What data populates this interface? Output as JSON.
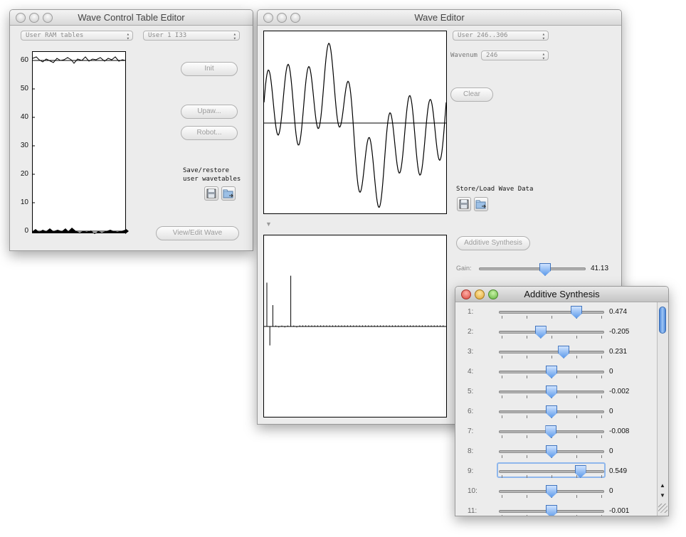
{
  "wave_control": {
    "title": "Wave Control Table Editor",
    "table_select": "User RAM tables",
    "user_select": "User   1 I33",
    "y_ticks": [
      "60",
      "50",
      "40",
      "30",
      "20",
      "10",
      "0"
    ],
    "init_label": "Init",
    "upaw_label": "Upaw...",
    "robot_label": "Robot...",
    "save_restore_line1": "Save/restore",
    "save_restore_line2": "user wavetables",
    "view_edit_label": "View/Edit Wave"
  },
  "wave_editor": {
    "title": "Wave Editor",
    "user_select": "User 246..306",
    "wavenum_label": "Wavenum",
    "wavenum_value": "246",
    "clear_label": "Clear",
    "store_load_label": "Store/Load Wave Data",
    "additive_button": "Additive Synthesis",
    "gain_label": "Gain:",
    "gain_value": "41.13",
    "gain_fraction": 0.62
  },
  "additive": {
    "title": "Additive Synthesis",
    "harmonics": [
      {
        "label": "1:",
        "value": "0.474",
        "amount": 0.474
      },
      {
        "label": "2:",
        "value": "-0.205",
        "amount": -0.205
      },
      {
        "label": "3:",
        "value": "0.231",
        "amount": 0.231
      },
      {
        "label": "4:",
        "value": "0",
        "amount": 0
      },
      {
        "label": "5:",
        "value": "-0.002",
        "amount": -0.002
      },
      {
        "label": "6:",
        "value": "0",
        "amount": 0
      },
      {
        "label": "7:",
        "value": "-0.008",
        "amount": -0.008
      },
      {
        "label": "8:",
        "value": "0",
        "amount": 0
      },
      {
        "label": "9:",
        "value": "0.549",
        "amount": 0.549
      },
      {
        "label": "10:",
        "value": "0",
        "amount": 0
      },
      {
        "label": "11:",
        "value": "-0.001",
        "amount": -0.001
      }
    ]
  },
  "icons": {
    "save": "floppy-disk-icon",
    "load": "folder-load-icon",
    "disclosure": "triangle-down-icon",
    "scroll_up": "arrow-up-icon",
    "scroll_down": "arrow-down-icon",
    "resize": "resize-grip-icon"
  },
  "colors": {
    "accent": "#5e9bea",
    "close": "#d8463c",
    "minimize": "#dfa536",
    "zoom": "#60b33c"
  }
}
